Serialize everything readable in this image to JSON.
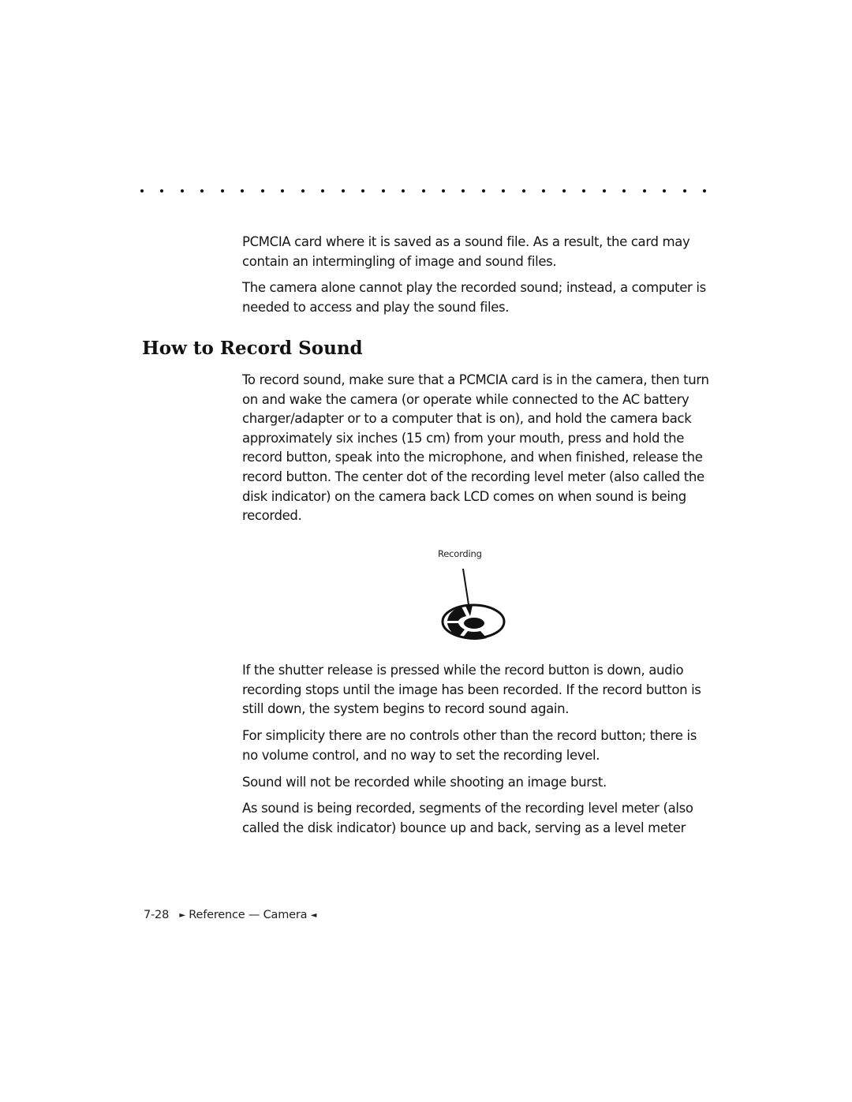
{
  "separator": {
    "dot_count": 29
  },
  "paragraphs_intro": [
    "PCMCIA card where it is saved as a sound file. As a result, the card may contain an intermingling of image and sound files.",
    "The camera alone cannot play the recorded sound; instead, a computer is needed to access and play the sound files."
  ],
  "section": {
    "heading": "How to Record Sound",
    "instructions": "To record sound, make sure that a PCMCIA card is in the camera, then turn on and wake the camera (or operate while connected to the AC battery charger/adapter or to a computer that is on), and hold the camera back approximately six inches (15 cm) from your mouth, press and hold the record button, speak into the microphone, and when finished, release the record button. The center dot of the recording level meter (also called the disk indicator) on the camera back LCD comes on when sound is being recorded."
  },
  "figure": {
    "label": "Recording",
    "icon": "disk-indicator-icon"
  },
  "paragraphs_after": [
    "If the shutter release is pressed while the record button is down, audio recording stops until the image has been recorded. If the record button is still down, the system begins to record sound again.",
    "For simplicity there are no controls other than the record button; there is no volume control, and no way to set the recording level.",
    "Sound will not be recorded while shooting an image burst.",
    "As sound is being recorded, segments of the recording level meter (also called the disk indicator) bounce up and back, serving as a level meter"
  ],
  "footer": {
    "page_number": "7-28",
    "left_marker": "►",
    "section_title": "Reference — Camera",
    "right_marker": "◄"
  }
}
